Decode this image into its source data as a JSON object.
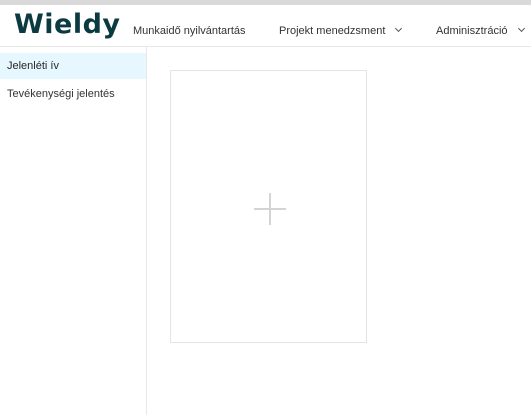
{
  "header": {
    "logo": "Wieldy",
    "nav": [
      {
        "label": "Munkaidő nyilvántartás",
        "has_dropdown": false
      },
      {
        "label": "Projekt menedzsment",
        "has_dropdown": true
      },
      {
        "label": "Adminisztráció",
        "has_dropdown": true
      }
    ]
  },
  "sidebar": {
    "items": [
      {
        "label": "Jelenléti ív",
        "active": true
      },
      {
        "label": "Tevékenységi jelentés",
        "active": false
      }
    ]
  },
  "main": {
    "add_card_icon": "plus-icon"
  },
  "colors": {
    "brand": "#0b3b41",
    "active_bg": "#e6f7ff",
    "border": "#e8e8e8",
    "plus": "#d4d4d4"
  }
}
